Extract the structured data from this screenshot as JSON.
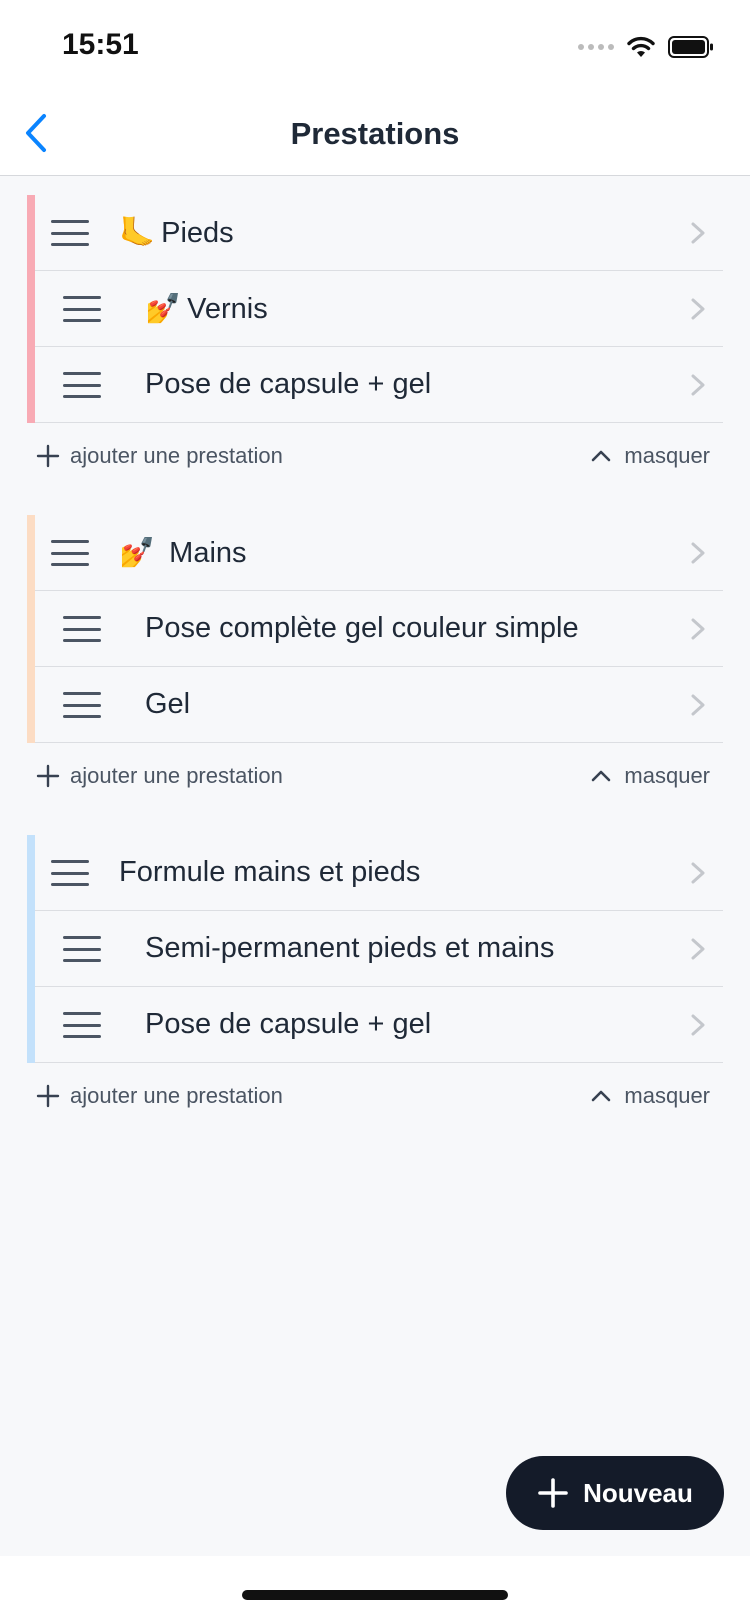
{
  "status_bar": {
    "time": "15:51"
  },
  "nav": {
    "title": "Prestations"
  },
  "groups": [
    {
      "color": "#f8aab4",
      "rows": [
        {
          "emoji": "🦶",
          "label": "Pieds"
        },
        {
          "emoji": "💅",
          "label": "Vernis"
        },
        {
          "emoji": "",
          "label": "Pose de capsule + gel"
        }
      ],
      "add_label": "ajouter une prestation",
      "hide_label": "masquer"
    },
    {
      "color": "#fcdcc3",
      "rows": [
        {
          "emoji": "💅",
          "label": "Mains"
        },
        {
          "emoji": "",
          "label": "Pose complète gel couleur simple"
        },
        {
          "emoji": "",
          "label": "Gel"
        }
      ],
      "add_label": "ajouter une prestation",
      "hide_label": "masquer"
    },
    {
      "color": "#c3e1fb",
      "rows": [
        {
          "emoji": "",
          "label": "Formule mains et pieds"
        },
        {
          "emoji": "",
          "label": "Semi-permanent pieds et mains"
        },
        {
          "emoji": "",
          "label": "Pose de capsule + gel"
        }
      ],
      "add_label": "ajouter une prestation",
      "hide_label": "masquer"
    }
  ],
  "new_button": {
    "label": "Nouveau"
  },
  "colors": {
    "accent": "#0a84ff",
    "fab": "#141b29"
  }
}
